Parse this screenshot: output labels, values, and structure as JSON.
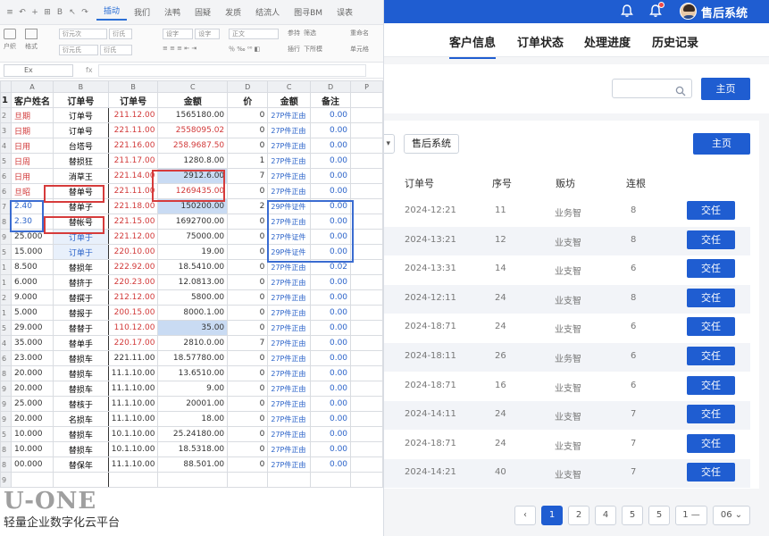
{
  "sheet": {
    "quick_icons": [
      "≡",
      "↶",
      "+",
      "⊞",
      "B",
      "↖",
      "↷"
    ],
    "menu": [
      "插动",
      "我们",
      "法鸭",
      "固疑",
      "发质",
      "结流人",
      "图寻BM",
      "误表"
    ],
    "ribbon": {
      "paste": "户织",
      "format": "格式",
      "font": "衍元次",
      "font_style": "衍氏",
      "size": "衍元氏",
      "border": "衍氏",
      "align1": "设字",
      "align2": "设字",
      "mode": "正文",
      "g1": "参持",
      "g2": "插行",
      "g3": "插标",
      "extra1": "筛选",
      "extra2": "下所模",
      "extra3": "重命名",
      "extra4": "单元格"
    },
    "name_box": "Ex",
    "fx": "fx",
    "col_letters": [
      "A",
      "B",
      "B",
      "C",
      "D",
      "C",
      "D",
      "P"
    ],
    "headers": [
      "客户姓名",
      "订单号",
      "订单号",
      "金额",
      "价",
      "金额",
      "备注"
    ],
    "rows": [
      {
        "n": "2",
        "name": "旦期",
        "ord": "订单号",
        "dt": "211.12.00",
        "amt": "1565180.00",
        "d": "0",
        "g": "27P件正由",
        "note": "0.00"
      },
      {
        "n": "3",
        "name": "日期",
        "ord": "订单号",
        "dt": "221.11.00",
        "amt": "2558095.02",
        "d": "0",
        "g": "27P件正由",
        "note": "0.00"
      },
      {
        "n": "4",
        "name": "日用",
        "ord": "台塔号",
        "dt": "221.16.00",
        "amt": "258.9687.50",
        "d": "0",
        "g": "27P件正由",
        "note": "0.00"
      },
      {
        "n": "5",
        "name": "日周",
        "ord": "替损狂",
        "dt": "211.17.00",
        "amt": "1280.8.00",
        "d": "1",
        "g": "27P件正由",
        "note": "0.00"
      },
      {
        "n": "6",
        "name": "日用",
        "ord": "消草王",
        "dt": "221.14.00",
        "amt": "2912.6.00",
        "d": "7",
        "g": "27P件正由",
        "note": "0.00"
      },
      {
        "n": "6",
        "name": "旦昭",
        "ord": "替单号",
        "dt": "221.11.00",
        "amt": "1269435.00",
        "d": "0",
        "g": "27P件正由",
        "note": "0.00"
      },
      {
        "n": "7",
        "name": "2.40",
        "ord": "替单子",
        "dt": "221.18.00",
        "amt": "150200.00",
        "d": "2",
        "g": "29P件证件",
        "note": "0.00"
      },
      {
        "n": "8",
        "name": "2.30",
        "ord": "替帐号",
        "dt": "221.15.00",
        "amt": "1692700.00",
        "d": "0",
        "g": "27P件正由",
        "note": "0.00"
      },
      {
        "n": "9",
        "name": "25.000",
        "ord": "订单于",
        "dt": "221.12.00",
        "amt": "75000.00",
        "d": "0",
        "g": "27P件证件",
        "note": "0.00"
      },
      {
        "n": "5",
        "name": "15.000",
        "ord": "订单于",
        "dt": "220.10.00",
        "amt": "19.00",
        "d": "0",
        "g": "29P件证件",
        "note": "0.00"
      },
      {
        "n": "1",
        "name": "8.500",
        "ord": "替损年",
        "dt": "222.92.00",
        "amt": "18.5410.00",
        "d": "0",
        "g": "27P件正由",
        "note": "0.02"
      },
      {
        "n": "1",
        "name": "6.000",
        "ord": "替挤于",
        "dt": "220.23.00",
        "amt": "12.0813.00",
        "d": "0",
        "g": "27P件正由",
        "note": "0.00"
      },
      {
        "n": "2",
        "name": "9.000",
        "ord": "替撰于",
        "dt": "212.12.00",
        "amt": "5800.00",
        "d": "0",
        "g": "27P件正由",
        "note": "0.00"
      },
      {
        "n": "1",
        "name": "5.000",
        "ord": "替报于",
        "dt": "200.15.00",
        "amt": "8000.1.00",
        "d": "0",
        "g": "27P件正由",
        "note": "0.00"
      },
      {
        "n": "5",
        "name": "29.000",
        "ord": "替替于",
        "dt": "110.12.00",
        "amt": "35.00",
        "d": "0",
        "g": "27P件正由",
        "note": "0.00"
      },
      {
        "n": "4",
        "name": "35.000",
        "ord": "替单手",
        "dt": "220.17.00",
        "amt": "2810.0.00",
        "d": "7",
        "g": "27P件正由",
        "note": "0.00"
      },
      {
        "n": "6",
        "name": "23.000",
        "ord": "替损车",
        "dt": "221.11.00",
        "amt": "18.57780.00",
        "d": "0",
        "g": "27P件正由",
        "note": "0.00"
      },
      {
        "n": "8",
        "name": "20.000",
        "ord": "替损车",
        "dt": "11.1.10.00",
        "amt": "13.6510.00",
        "d": "0",
        "g": "27P件正由",
        "note": "0.00"
      },
      {
        "n": "9",
        "name": "20.000",
        "ord": "替损车",
        "dt": "11.1.10.00",
        "amt": "9.00",
        "d": "0",
        "g": "27P件正由",
        "note": "0.00"
      },
      {
        "n": "9",
        "name": "25.000",
        "ord": "替核于",
        "dt": "11.1.10.00",
        "amt": "20001.00",
        "d": "0",
        "g": "27P件正由",
        "note": "0.00"
      },
      {
        "n": "9",
        "name": "20.000",
        "ord": "名损车",
        "dt": "11.1.10.00",
        "amt": "18.00",
        "d": "0",
        "g": "27P件正由",
        "note": "0.00"
      },
      {
        "n": "5",
        "name": "10.000",
        "ord": "替损车",
        "dt": "10.1.10.00",
        "amt": "25.24180.00",
        "d": "0",
        "g": "27P件正由",
        "note": "0.00"
      },
      {
        "n": "8",
        "name": "10.000",
        "ord": "替损车",
        "dt": "10.1.10.00",
        "amt": "18.5318.00",
        "d": "0",
        "g": "27P件正由",
        "note": "0.00"
      },
      {
        "n": "8",
        "name": "00.000",
        "ord": "替保年",
        "dt": "11.1.10.00",
        "amt": "88.501.00",
        "d": "0",
        "g": "27P件正由",
        "note": "0.00"
      },
      {
        "n": "9",
        "name": "",
        "ord": "",
        "dt": "",
        "amt": "",
        "d": "",
        "g": "",
        "note": ""
      }
    ]
  },
  "logo": {
    "brand": "U-ONE",
    "tagline": "轻量企业数字化云平台"
  },
  "app": {
    "system_name": "售后系统",
    "tabs": [
      "客户信息",
      "订单状态",
      "处理进度",
      "历史记录"
    ],
    "search_placeholder": "",
    "home_label": "主页",
    "home_label2": "主页",
    "after_sales_label": "售后系统",
    "left_edge": "▾",
    "table_headers": [
      "订单号",
      "序号",
      "贩坊",
      "连根"
    ],
    "rows": [
      {
        "date": "2024-12:21",
        "num": "11",
        "owner": "业务智",
        "val": "8",
        "action": "交任"
      },
      {
        "date": "2024-13:21",
        "num": "12",
        "owner": "业支智",
        "val": "8",
        "action": "交任"
      },
      {
        "date": "2024-13:31",
        "num": "14",
        "owner": "业支智",
        "val": "6",
        "action": "交任"
      },
      {
        "date": "2024-12:11",
        "num": "24",
        "owner": "业支智",
        "val": "8",
        "action": "交任"
      },
      {
        "date": "2024-18:71",
        "num": "24",
        "owner": "业支智",
        "val": "6",
        "action": "交任"
      },
      {
        "date": "2024-18:11",
        "num": "26",
        "owner": "业务智",
        "val": "6",
        "action": "交任"
      },
      {
        "date": "2024-18:71",
        "num": "16",
        "owner": "业支智",
        "val": "6",
        "action": "交任"
      },
      {
        "date": "2024-14:11",
        "num": "24",
        "owner": "业支智",
        "val": "7",
        "action": "交任"
      },
      {
        "date": "2024-18:71",
        "num": "24",
        "owner": "业支智",
        "val": "7",
        "action": "交任"
      },
      {
        "date": "2024-14:21",
        "num": "40",
        "owner": "业支智",
        "val": "7",
        "action": "交任"
      }
    ],
    "pagination": {
      "prev": "‹",
      "pages": [
        "1",
        "2",
        "4",
        "5",
        "5",
        "1 —"
      ],
      "page_size": "06 ⌄"
    }
  }
}
